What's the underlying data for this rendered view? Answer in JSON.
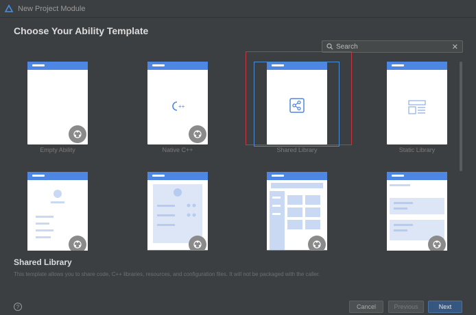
{
  "window": {
    "title": "New Project Module"
  },
  "heading": "Choose Your Ability Template",
  "search": {
    "value": "Search"
  },
  "templates": [
    {
      "label": "Empty Ability",
      "icon": "blank-page-icon"
    },
    {
      "label": "Native C++",
      "icon": "cpp-icon"
    },
    {
      "label": "Shared Library",
      "icon": "share-icon",
      "selected": true
    },
    {
      "label": "Static Library",
      "icon": "static-library-icon"
    },
    {
      "label": "",
      "icon": "profile-page-icon"
    },
    {
      "label": "",
      "icon": "detail-page-icon"
    },
    {
      "label": "",
      "icon": "list-grid-page-icon"
    },
    {
      "label": "",
      "icon": "form-page-icon"
    }
  ],
  "description": {
    "title": "Shared Library",
    "text": "This template allows you to share code, C++ libraries, resources, and configuration files. It will not be packaged with the caller."
  },
  "footer": {
    "cancel_label": "Cancel",
    "previous_label": "Previous",
    "next_label": "Next"
  },
  "colors": {
    "background": "#3c3f41",
    "accent_blue": "#4e86e3",
    "selection_red": "#c7353d",
    "primary_button": "#365880"
  }
}
